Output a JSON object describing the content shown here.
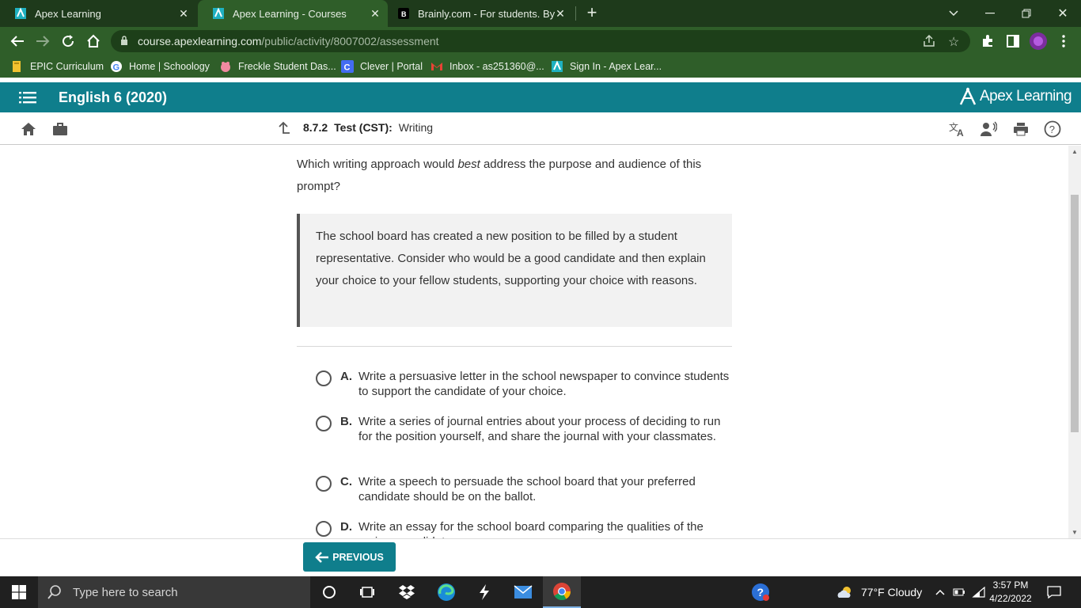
{
  "browser": {
    "tabs": [
      {
        "title": "Apex Learning",
        "active": false
      },
      {
        "title": "Apex Learning - Courses",
        "active": true
      },
      {
        "title": "Brainly.com - For students. By stu",
        "active": false
      }
    ],
    "new_tab": "+",
    "url_host": "course.apexlearning.com",
    "url_path": "/public/activity/8007002/assessment",
    "bookmarks": [
      {
        "label": "EPIC Curriculum",
        "icon": "bookmark-folder-icon"
      },
      {
        "label": "Home | Schoology",
        "icon": "google-icon"
      },
      {
        "label": "Freckle Student Das...",
        "icon": "freckle-icon"
      },
      {
        "label": "Clever | Portal",
        "icon": "clever-icon"
      },
      {
        "label": "Inbox - as251360@...",
        "icon": "gmail-icon"
      },
      {
        "label": "Sign In - Apex Lear...",
        "icon": "apex-icon"
      }
    ],
    "colors": {
      "frame": "#1e3a1b",
      "toolbar": "#2f5e29"
    }
  },
  "app": {
    "course_title": "English 6 (2020)",
    "brand": "Apex Learning",
    "brand_color": "#0f7e8c"
  },
  "subnav": {
    "activity_number": "8.7.2",
    "activity_type": "Test (CST):",
    "activity_name": "Writing"
  },
  "question": {
    "prefix": "Which writing approach would ",
    "emphasis": "best",
    "suffix": " address the purpose and audience of this prompt?",
    "prompt": "The school board has created a new position to be filled by a student representative. Consider who would be a good candidate and then explain your choice to your fellow students, supporting your choice with reasons."
  },
  "options": [
    {
      "letter": "A.",
      "text": "Write a persuasive letter in the school newspaper to convince students to support the candidate of your choice."
    },
    {
      "letter": "B.",
      "text": "Write a series of journal entries about your process of deciding to run for the position yourself, and share the journal with your classmates."
    },
    {
      "letter": "C.",
      "text": "Write a speech to persuade the school board that your preferred candidate should be on the ballot."
    },
    {
      "letter": "D.",
      "text": "Write an essay for the school board comparing the qualities of the various candidates."
    }
  ],
  "footer": {
    "previous_label": "PREVIOUS"
  },
  "taskbar": {
    "search_placeholder": "Type here to search",
    "weather": "77°F  Cloudy",
    "time": "3:57 PM",
    "date": "4/22/2022"
  }
}
